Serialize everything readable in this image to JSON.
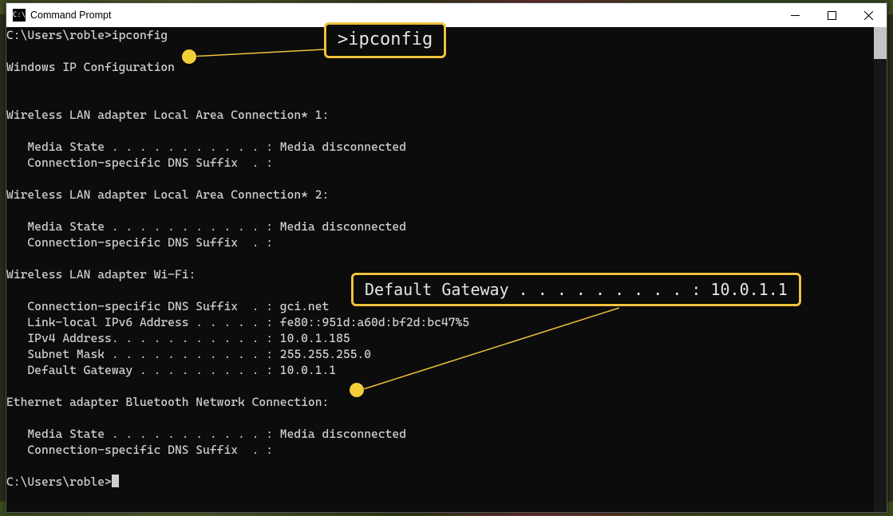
{
  "window": {
    "title": "Command Prompt",
    "icon": "C:\\"
  },
  "callouts": {
    "cmd": ">ipconfig",
    "gateway": "Default Gateway . . . . . . . . . : 10.0.1.1"
  },
  "terminal": {
    "prompt1": "C:\\Users\\roble>ipconfig",
    "header": "Windows IP Configuration",
    "sec1_title": "Wireless LAN adapter Local Area Connection* 1:",
    "sec1_l1": "   Media State . . . . . . . . . . . : Media disconnected",
    "sec1_l2": "   Connection-specific DNS Suffix  . :",
    "sec2_title": "Wireless LAN adapter Local Area Connection* 2:",
    "sec2_l1": "   Media State . . . . . . . . . . . : Media disconnected",
    "sec2_l2": "   Connection-specific DNS Suffix  . :",
    "sec3_title": "Wireless LAN adapter Wi-Fi:",
    "sec3_l1": "   Connection-specific DNS Suffix  . : gci.net",
    "sec3_l2": "   Link-local IPv6 Address . . . . . : fe80::951d:a60d:bf2d:bc47%5",
    "sec3_l3": "   IPv4 Address. . . . . . . . . . . : 10.0.1.185",
    "sec3_l4": "   Subnet Mask . . . . . . . . . . . : 255.255.255.0",
    "sec3_l5": "   Default Gateway . . . . . . . . . : 10.0.1.1",
    "sec4_title": "Ethernet adapter Bluetooth Network Connection:",
    "sec4_l1": "   Media State . . . . . . . . . . . : Media disconnected",
    "sec4_l2": "   Connection-specific DNS Suffix  . :",
    "prompt2": "C:\\Users\\roble>"
  }
}
